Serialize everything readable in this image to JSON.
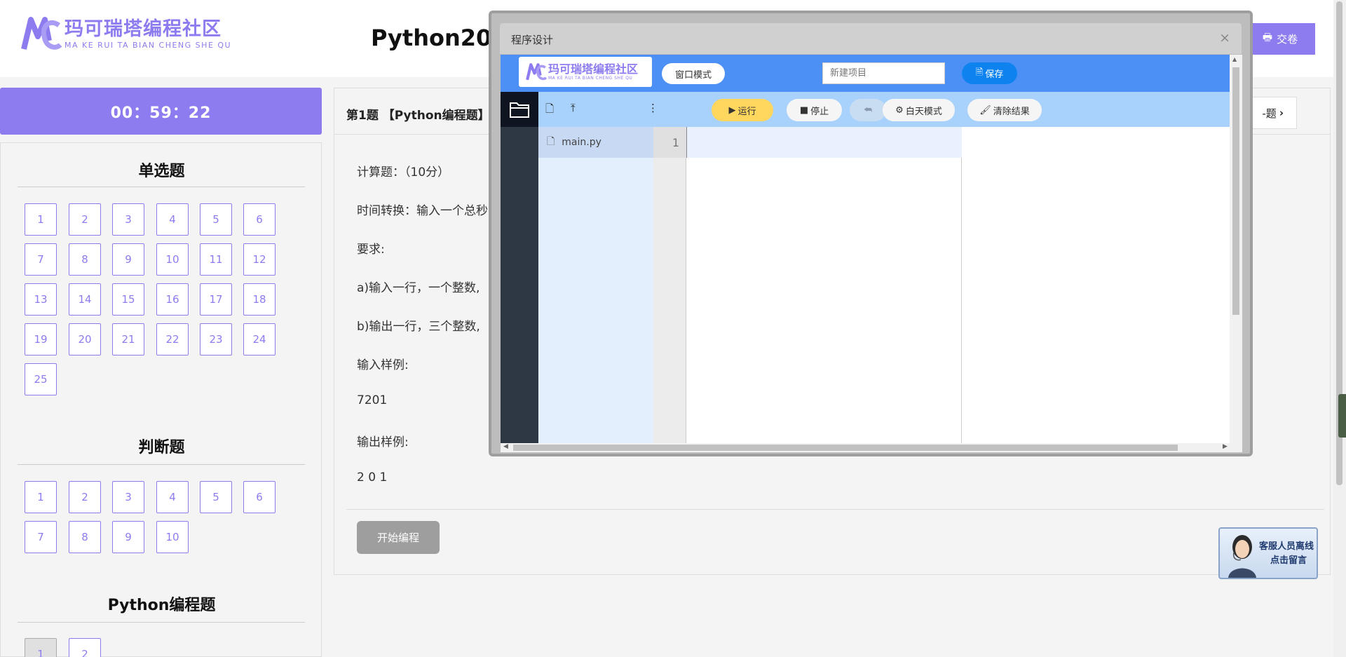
{
  "header": {
    "brand_cn": "玛可瑞塔编程社区",
    "brand_en": "MA KE RUI TA BIAN CHENG SHE QU",
    "exam_title": "Python202",
    "submit_label": "交卷"
  },
  "timer": "00：59：22",
  "sections": [
    {
      "title": "单选题",
      "numbers": [
        "1",
        "2",
        "3",
        "4",
        "5",
        "6",
        "7",
        "8",
        "9",
        "10",
        "11",
        "12",
        "13",
        "14",
        "15",
        "16",
        "17",
        "18",
        "19",
        "20",
        "21",
        "22",
        "23",
        "24",
        "25"
      ]
    },
    {
      "title": "判断题",
      "numbers": [
        "1",
        "2",
        "3",
        "4",
        "5",
        "6",
        "7",
        "8",
        "9",
        "10"
      ]
    },
    {
      "title": "Python编程题",
      "numbers": [
        "1",
        "2"
      ],
      "current": "1"
    }
  ],
  "question": {
    "title": "第1题 【Python编程题】",
    "next_label": "-题",
    "lines": [
      "计算题：（10分）",
      "时间转换：输入一个总秒",
      "要求:",
      "a)输入一行，一个整数,",
      "b)输出一行，三个整数,",
      "输入样例:",
      "7201",
      "输出样例:",
      "2 0 1"
    ],
    "start_label": "开始编程"
  },
  "modal": {
    "title": "程序设计",
    "close": "×",
    "ide": {
      "logo_cn": "玛可瑞塔编程社区",
      "logo_en": "MA KE RUI TA BIAN CHENG SHE QU",
      "window_mode": "窗口模式",
      "project_placeholder": "新建项目",
      "save_label": "保存",
      "run_label": "运行",
      "stop_label": "停止",
      "day_mode_label": "白天模式",
      "clear_label": "清除结果",
      "more_glyph": "⋮",
      "file_name": "main.py",
      "line_number": "1"
    }
  },
  "customer_service": {
    "line1": "客服人员离线",
    "line2": "点击留言"
  },
  "colors": {
    "accent": "#8c7cf0",
    "ide_blue": "#4c90f5",
    "toolbar_blue": "#a8d2fb",
    "run_yellow": "#ffd65e",
    "save_blue": "#0e83f0"
  }
}
